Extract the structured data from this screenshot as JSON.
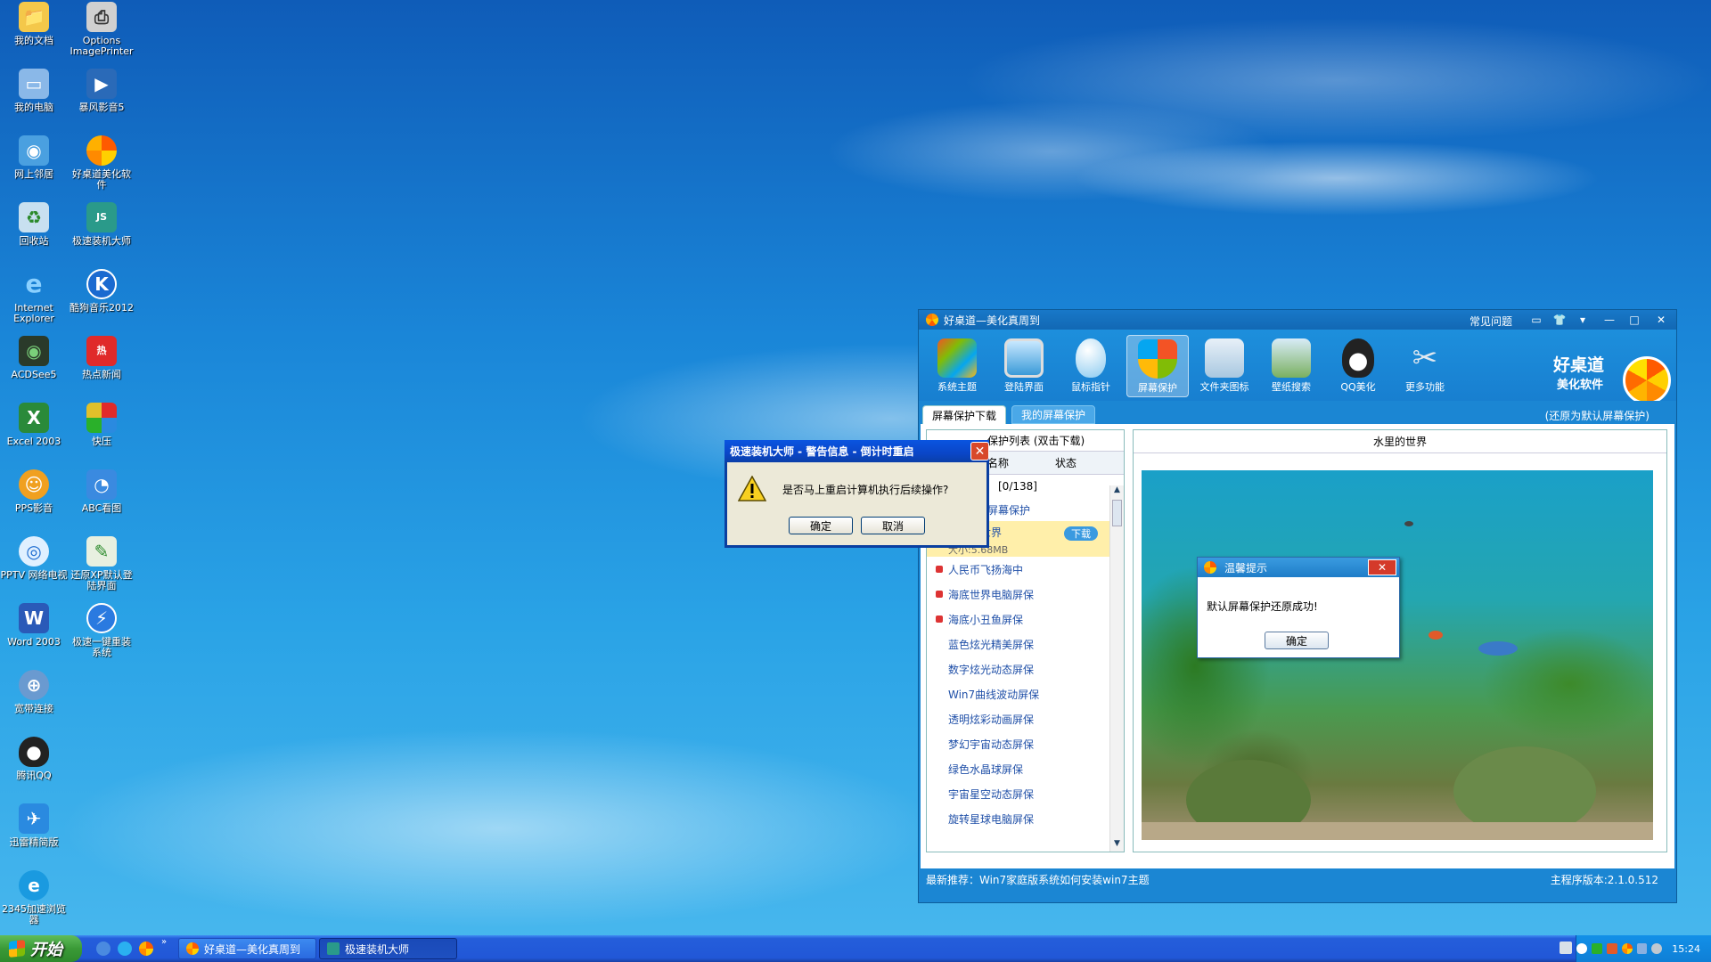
{
  "desktop": {
    "icons": [
      {
        "label": "我的文档",
        "icon": "my-documents-icon"
      },
      {
        "label": "Options ImagePrinter",
        "icon": "printer-icon"
      },
      {
        "label": "我的电脑",
        "icon": "my-computer-icon"
      },
      {
        "label": "暴风影音5",
        "icon": "media-player-icon"
      },
      {
        "label": "网上邻居",
        "icon": "network-icon"
      },
      {
        "label": "好桌道美化软件",
        "icon": "haozhuodao-icon"
      },
      {
        "label": "回收站",
        "icon": "recycle-bin-icon"
      },
      {
        "label": "极速装机大师",
        "icon": "js-installer-icon"
      },
      {
        "label": "Internet Explorer",
        "icon": "ie-icon"
      },
      {
        "label": "酷狗音乐2012",
        "icon": "kugou-icon"
      },
      {
        "label": "ACDSee5",
        "icon": "acdsee-icon"
      },
      {
        "label": "热点新闻",
        "icon": "hot-news-icon"
      },
      {
        "label": "Excel 2003",
        "icon": "excel-icon"
      },
      {
        "label": "快压",
        "icon": "kuaiya-icon"
      },
      {
        "label": "PPS影音",
        "icon": "pps-icon"
      },
      {
        "label": "ABC看图",
        "icon": "abc-viewer-icon"
      },
      {
        "label": "PPTV 网络电视",
        "icon": "pptv-icon"
      },
      {
        "label": "还原XP默认登陆界面",
        "icon": "restore-login-icon"
      },
      {
        "label": "Word 2003",
        "icon": "word-icon"
      },
      {
        "label": "极速一键重装系统",
        "icon": "reinstall-icon"
      },
      {
        "label": "宽带连接",
        "icon": "broadband-icon"
      },
      {
        "label": "腾讯QQ",
        "icon": "qq-icon"
      },
      {
        "label": "迅雷精简版",
        "icon": "xunlei-icon"
      },
      {
        "label": "2345加速浏览器",
        "icon": "browser-2345-icon"
      }
    ]
  },
  "app": {
    "title": "好桌道—美化真周到",
    "header_links": {
      "faq": "常见问题"
    },
    "toolbar": [
      {
        "label": "系统主题",
        "icon": "windows-theme-icon",
        "color": "#3a9ad8"
      },
      {
        "label": "登陆界面",
        "icon": "monitor-icon",
        "color": "#5ab0e0"
      },
      {
        "label": "鼠标指针",
        "icon": "mouse-icon",
        "color": "#8acaf0"
      },
      {
        "label": "屏幕保护",
        "icon": "shield-icon",
        "color": "#f0a020",
        "active": true
      },
      {
        "label": "文件夹图标",
        "icon": "folder-icon",
        "color": "#b0d0e8"
      },
      {
        "label": "壁纸搜索",
        "icon": "wallpaper-search-icon",
        "color": "#8ac070"
      },
      {
        "label": "QQ美化",
        "icon": "qq-penguin-icon",
        "color": "#222222"
      },
      {
        "label": "更多功能",
        "icon": "tools-icon",
        "color": "#c0c8d0"
      }
    ],
    "brand": {
      "name": "好桌道",
      "sub": "美化软件"
    },
    "tabs": [
      {
        "label": "屏幕保护下载",
        "active": true
      },
      {
        "label": "我的屏幕保护",
        "active": false
      }
    ],
    "restore_default": "(还原为默认屏幕保护)",
    "list": {
      "header": "保护列表 (双击下载)",
      "col_name": "名称",
      "col_status": "状态",
      "count": "[0/138]",
      "group": "屏幕保护",
      "selected": {
        "name": "水里的世界",
        "size": "大小:5.68MB",
        "action": "下载"
      },
      "items": [
        "人民币飞扬海中",
        "海底世界电脑屏保",
        "海底小丑鱼屏保",
        "蓝色炫光精美屏保",
        "数字炫光动态屏保",
        "Win7曲线波动屏保",
        "透明炫彩动画屏保",
        "梦幻宇宙动态屏保",
        "绿色水晶球屏保",
        "宇宙星空动态屏保",
        "旋转星球电脑屏保"
      ]
    },
    "preview_title": "水里的世界",
    "status_left": "最新推荐：Win7家庭版系统如何安装win7主题",
    "status_right": "主程序版本:2.1.0.512"
  },
  "popup": {
    "title": "温馨提示",
    "message": "默认屏幕保护还原成功!",
    "ok": "确定"
  },
  "dialog": {
    "title": "极速装机大师 - 警告信息 - 倒计时重启",
    "message": "是否马上重启计算机执行后续操作?",
    "ok": "确定",
    "cancel": "取消"
  },
  "taskbar": {
    "start": "开始",
    "tasks": [
      {
        "label": "好桌道—美化真周到",
        "active": false
      },
      {
        "label": "极速装机大师",
        "active": true
      }
    ],
    "clock": "15:24"
  }
}
